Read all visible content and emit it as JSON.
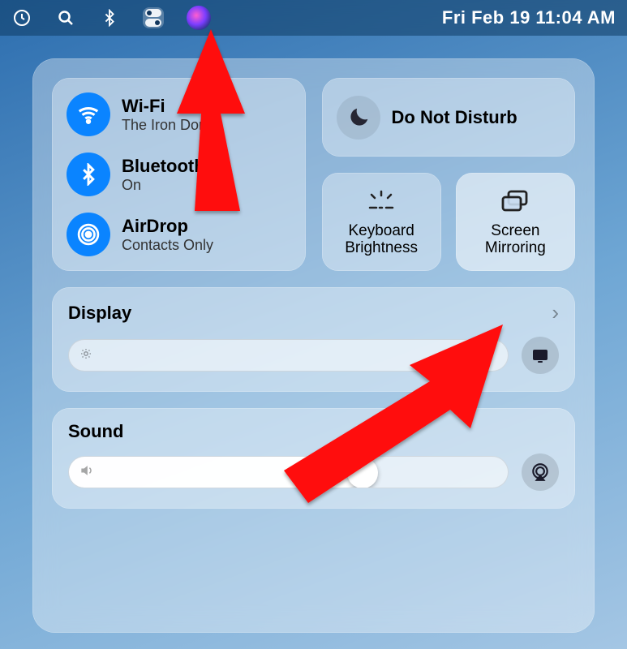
{
  "menubar": {
    "datetime": "Fri Feb 19  11:04 AM"
  },
  "connectivity": {
    "wifi": {
      "title": "Wi-Fi",
      "subtitle": "The Iron Dome"
    },
    "bt": {
      "title": "Bluetooth",
      "subtitle": "On"
    },
    "airdrop": {
      "title": "AirDrop",
      "subtitle": "Contacts Only"
    }
  },
  "dnd": {
    "title": "Do Not Disturb"
  },
  "small": {
    "keyboard": "Keyboard Brightness",
    "mirror": "Screen Mirroring"
  },
  "display": {
    "title": "Display"
  },
  "sound": {
    "title": "Sound"
  }
}
